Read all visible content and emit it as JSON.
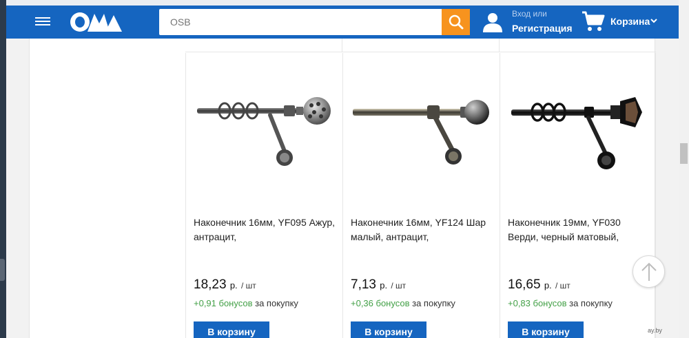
{
  "header": {
    "search_placeholder": "OSB",
    "login_label": "Вход или",
    "register_label": "Регистрация",
    "cart_label": "Корзина"
  },
  "colors": {
    "header_bg": "#1565c0",
    "accent_orange": "#f7931e",
    "bonus_green": "#43a047",
    "button_blue": "#1565c0"
  },
  "products": [
    {
      "name": "Наконечник 16мм, YF095 Ажур, антрацит,",
      "price": "18,23",
      "currency": "р.",
      "unit": "/ шт",
      "bonus": "+0,91 бонусов",
      "bonus_suffix": "за покупку",
      "button": "В корзину",
      "image_icon": "curtain-rod-openwork-finial"
    },
    {
      "name": "Наконечник 16мм, YF124 Шар малый, антрацит,",
      "price": "7,13",
      "currency": "р.",
      "unit": "/ шт",
      "bonus": "+0,36 бонусов",
      "bonus_suffix": "за покупку",
      "button": "В корзину",
      "image_icon": "curtain-rod-ball-finial"
    },
    {
      "name": "Наконечник 19мм, YF030 Верди, черный матовый,",
      "price": "16,65",
      "currency": "р.",
      "unit": "/ шт",
      "bonus": "+0,83 бонусов",
      "bonus_suffix": "за покупку",
      "button": "В корзину",
      "image_icon": "curtain-rod-pyramid-finial"
    }
  ],
  "watermark": "ay.by"
}
